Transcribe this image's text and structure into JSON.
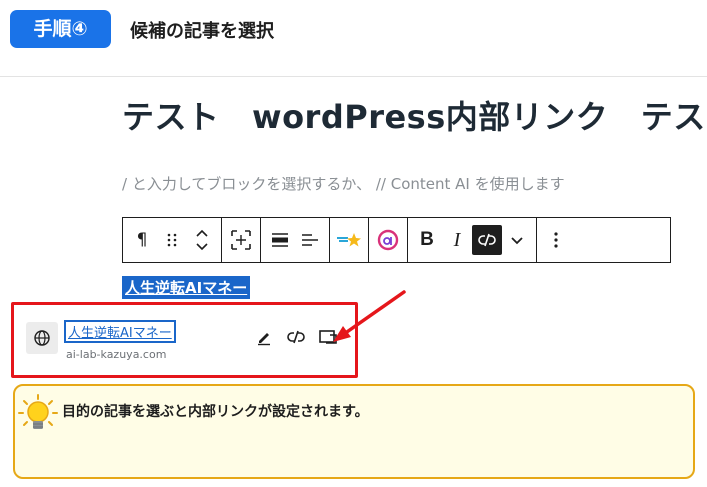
{
  "step": {
    "badge": "手順④",
    "title": "候補の記事を選択"
  },
  "editor": {
    "post_title": "テスト　wordPress内部リンク　テスト",
    "placeholder": "/ と入力してブロックを選択するか、 // Content AI を使用します"
  },
  "toolbar": {
    "icons": [
      "paragraph-icon",
      "drag-handle-icon",
      "move-up-down-icon",
      "align-block-icon",
      "align-full-icon",
      "align-text-icon",
      "ai-star-icon",
      "ai-logo-icon",
      "bold-icon",
      "italic-icon",
      "unlink-icon",
      "more-dropdown-icon",
      "options-icon"
    ],
    "bold_label": "B",
    "italic_label": "I",
    "paragraph_label": "¶"
  },
  "selected_text": "人生逆転AIマネー",
  "link_popover": {
    "title": "人生逆転AIマネー",
    "url": "ai-lab-kazuya.com",
    "actions": [
      "edit-pencil-icon",
      "unlink-icon",
      "open-new-tab-icon"
    ]
  },
  "note": {
    "text": "目的の記事を選ぶと内部リンクが設定されます。"
  },
  "colors": {
    "accent_blue": "#1a73e8",
    "highlight_red": "#e5161b",
    "note_border": "#e6a817",
    "note_bg": "#fffde6"
  }
}
